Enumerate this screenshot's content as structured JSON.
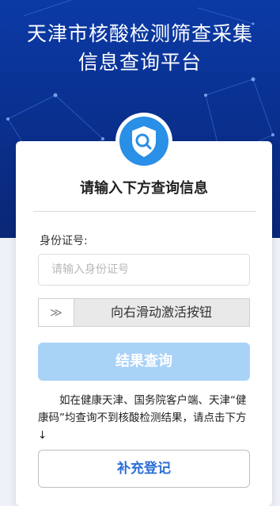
{
  "header": {
    "title_line1": "天津市核酸检测筛查采集",
    "title_line2": "信息查询平台"
  },
  "form": {
    "heading": "请输入下方查询信息",
    "id_label": "身份证号:",
    "id_value": "",
    "id_placeholder": "请输入身份证号",
    "slider_handle": "≫",
    "slider_text": "向右滑动激活按钮",
    "query_button": "结果查询",
    "notice": "如在健康天津、国务院客户端、天津“健康码”均查询不到核酸检测结果，请点击下方 ↓",
    "supplement_button": "补充登记"
  },
  "icons": {
    "badge": "shield-search-icon"
  },
  "colors": {
    "banner": "#0b3aa6",
    "accent": "#2a8fe6",
    "query_button_disabled": "#a9d2f7",
    "link_text": "#2a6fd6"
  }
}
